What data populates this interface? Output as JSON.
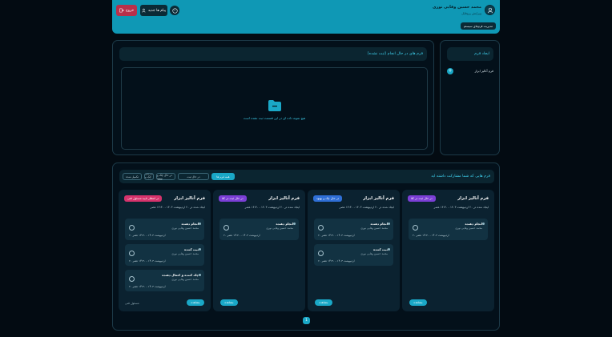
{
  "header": {
    "user_name": "محمد حسین وفایی نوری",
    "user_role": "ویرایش پروفایل",
    "logout_label": "خروج",
    "requests_label": "پیام ها جدید",
    "admin_label": "مدیریت فرم‌های سیستم",
    "colors": {
      "bar": "#0f98b5",
      "logout": "#b8304a"
    }
  },
  "sidebar": {
    "title": "ایجاد فرم",
    "item_label": "فرم آنالیز ابزار"
  },
  "in_progress": {
    "title": "فرم های در حال انجام (ثبت نشده)",
    "empty_text": "هیچ نمونه داده ای در این قسمت ثبت نشده است"
  },
  "participation": {
    "title": "فرم هایی که شما مشارکت داشته اید",
    "tabs": [
      "همه فرم ها",
      "در حال ثبت",
      "در حال چک و بهبود",
      "در حال چک و تایید",
      "تکمیل شده"
    ],
    "columns": [
      {
        "title": "فرم آنالیز ابزار",
        "badge": "در حال ثبت در کلا",
        "badge_color": "#7b3fd6",
        "created": "ایجاد شده در ۲۰ اردیبهشت ۱۴۰۳ - ۱۴:۳۰ عصر",
        "cards": [
          {
            "name": "انجام دهنده",
            "by": "محمد حسین وفایی نوری",
            "date": "۲۰ اردیبهشت ۱۴۰۳ - ۱۴:۳۰ عصر"
          }
        ],
        "view_label": "مشاهده",
        "footer": ""
      },
      {
        "title": "فرم آنالیز ابزار",
        "badge": "در حال چک و بهبود",
        "badge_color": "#2f6fd6",
        "created": "ایجاد شده در ۲۰ اردیبهشت ۱۴۰۳ - ۱۴:۳۰ عصر",
        "cards": [
          {
            "name": "انجام دهنده",
            "by": "محمد حسین وفایی نوری",
            "date": "۲۰ اردیبهشت ۱۴۰۳ - ۱۴:۳۰ عصر"
          },
          {
            "name": "ثبت کننده",
            "by": "محمد حسین وفایی نوری",
            "date": "۲۰ اردیبهشت ۱۴۰۳ - ۱۴:۳۰ عصر"
          }
        ],
        "view_label": "مشاهده",
        "footer": ""
      },
      {
        "title": "فرم آنالیز ابزار",
        "badge": "در حال ثبت در کلا",
        "badge_color": "#7b3fd6",
        "created": "ایجاد شده در ۲۰ اردیبهشت ۱۴۰۳ - ۱۴:۳۰ عصر",
        "cards": [
          {
            "name": "انجام دهنده",
            "by": "محمد حسین وفایی نوری",
            "date": "۲۰ اردیبهشت ۱۴۰۳ - ۱۴:۳۰ عصر"
          }
        ],
        "view_label": "مشاهده",
        "footer": ""
      },
      {
        "title": "فرم آنالیز ابزار",
        "badge": "در انتظار تایید مسئول فنی",
        "badge_color": "#d6336c",
        "created": "ایجاد شده در ۲۰ اردیبهشت ۱۴۰۳ - ۱۴:۳۰ عصر",
        "cards": [
          {
            "name": "انجام دهنده",
            "by": "محمد حسین وفایی نوری",
            "date": "۲۰ اردیبهشت ۱۴۰۳ - ۱۴:۳۰ عصر"
          },
          {
            "name": "ثبت کننده",
            "by": "محمد حسین وفایی نوری",
            "date": "۲۰ اردیبهشت ۱۴۰۳ - ۱۴:۳۰ عصر"
          },
          {
            "name": "چک کننده و اعمال دهنده",
            "by": "محمد حسین وفایی نوری",
            "date": "۲۰ اردیبهشت ۱۴۰۳ - ۱۴:۳۰ عصر"
          }
        ],
        "view_label": "مشاهده",
        "footer": "مسئول فنی"
      }
    ],
    "pagination": {
      "current": "1"
    }
  }
}
